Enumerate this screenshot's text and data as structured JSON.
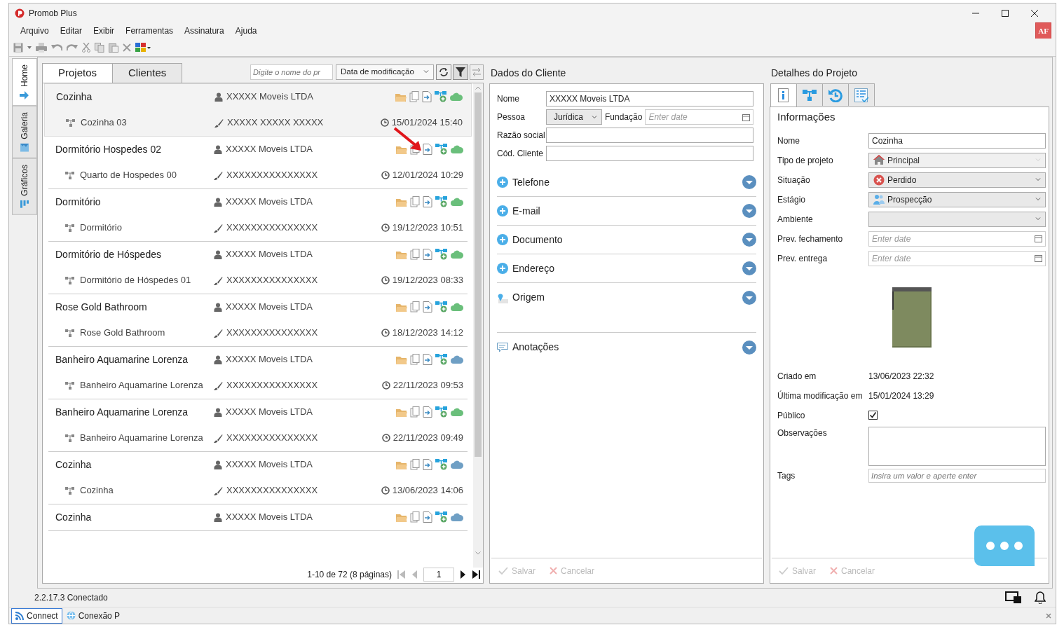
{
  "window": {
    "title": "Promob Plus"
  },
  "menu": [
    "Arquivo",
    "Editar",
    "Exibir",
    "Ferramentas",
    "Assinatura",
    "Ajuda"
  ],
  "user_badge": "AF",
  "side_tabs": [
    {
      "label": "Home",
      "selected": true
    },
    {
      "label": "Galeria",
      "selected": false
    },
    {
      "label": "Gráficos",
      "selected": false
    }
  ],
  "projects_panel": {
    "tabs": [
      {
        "label": "Projetos",
        "selected": true
      },
      {
        "label": "Clientes",
        "selected": false
      }
    ],
    "search": {
      "placeholder": "Digite o nome do pr"
    },
    "sort": "Data de modificação",
    "items": [
      {
        "title": "Cozinha",
        "client": "XXXXX Moveis LTDA",
        "subtitle": "Cozinha 03",
        "designer": "XXXXX XXXXX XXXXX",
        "date": "15/01/2024 15:40",
        "color": "#6abf7b",
        "selected": true
      },
      {
        "title": "Dormitório Hospedes 02",
        "client": "XXXXX Moveis LTDA",
        "subtitle": "Quarto de Hospedes 00",
        "designer": "XXXXXXXXXXXXXXX",
        "date": "12/01/2024 10:29",
        "color": "#6abf7b",
        "selected": false
      },
      {
        "title": "Dormitório",
        "client": "XXXXX Moveis LTDA",
        "subtitle": "Dormitório",
        "designer": "XXXXXXXXXXXXXXX",
        "date": "19/12/2023 10:51",
        "color": "#6abf7b",
        "selected": false
      },
      {
        "title": "Dormitório de Hóspedes",
        "client": "XXXXX Moveis LTDA",
        "subtitle": "Dormitório de Hóspedes 01",
        "designer": "XXXXXXXXXXXXXXX",
        "date": "19/12/2023 08:33",
        "color": "#6abf7b",
        "selected": false
      },
      {
        "title": "Rose Gold Bathroom",
        "client": "XXXXX Moveis LTDA",
        "subtitle": "Rose Gold Bathroom",
        "designer": "XXXXXXXXXXXXXXX",
        "date": "18/12/2023 14:12",
        "color": "#6abf7b",
        "selected": false
      },
      {
        "title": "Banheiro Aquamarine Lorenza",
        "client": "XXXXX Moveis LTDA",
        "subtitle": "Banheiro Aquamarine Lorenza",
        "designer": "XXXXXXXXXXXXXXX",
        "date": "22/11/2023 09:53",
        "color": "#6f9fc4",
        "selected": false
      },
      {
        "title": "Banheiro Aquamarine Lorenza",
        "client": "XXXXX Moveis LTDA",
        "subtitle": "Banheiro Aquamarine Lorenza",
        "designer": "XXXXXXXXXXXXXXX",
        "date": "22/11/2023 09:49",
        "color": "#6abf7b",
        "selected": false
      },
      {
        "title": "Cozinha",
        "client": "XXXXX Moveis LTDA",
        "subtitle": "Cozinha",
        "designer": "XXXXXXXXXXXXXXX",
        "date": "13/06/2023 14:06",
        "color": "#6f9fc4",
        "selected": false
      },
      {
        "title": "Cozinha",
        "client": "XXXXX Moveis LTDA",
        "color": "#6f9fc4",
        "selected": false
      }
    ],
    "pagination": {
      "summary": "1-10 de 72 (8 páginas)",
      "page": "1"
    }
  },
  "client_panel": {
    "title": "Dados do Cliente",
    "fields": [
      {
        "kind": "text",
        "label": "Nome",
        "value": "XXXXX Moveis LTDA"
      },
      {
        "kind": "select_date",
        "label": "Pessoa",
        "value": "Jurídica",
        "date_label": "Fundação",
        "date_placeholder": "Enter date"
      },
      {
        "kind": "text",
        "label": "Razão social"
      },
      {
        "kind": "text",
        "label": "Cód. Cliente"
      }
    ],
    "sections": [
      {
        "label": "Telefone",
        "kind": "plus"
      },
      {
        "label": "E-mail",
        "kind": "plus"
      },
      {
        "label": "Documento",
        "kind": "plus"
      },
      {
        "label": "Endereço",
        "kind": "plus"
      },
      {
        "label": "Origem",
        "kind": "pin"
      },
      {
        "label": "Anotações",
        "kind": "note"
      }
    ],
    "buttons": [
      {
        "label": "Salvar",
        "kind": "save",
        "disabled": true
      },
      {
        "label": "Cancelar",
        "kind": "cancel",
        "disabled": true
      }
    ]
  },
  "project_panel": {
    "title": "Detalhes do Projeto",
    "tabs": [
      {
        "kind": "info",
        "selected": true
      },
      {
        "kind": "hierarchy",
        "selected": false
      },
      {
        "kind": "history",
        "selected": false
      },
      {
        "kind": "checklist",
        "selected": false
      }
    ],
    "heading": "Informações",
    "fields": [
      {
        "kind": "text",
        "label": "Nome",
        "value": "Cozinha"
      },
      {
        "kind": "select",
        "label": "Tipo de projeto",
        "value": "Principal",
        "disabled": true
      },
      {
        "kind": "select",
        "label": "Situação",
        "value": "Perdido",
        "disabled": false
      },
      {
        "kind": "select",
        "label": "Estágio",
        "value": "Prospecção",
        "disabled": false
      },
      {
        "kind": "select",
        "label": "Ambiente",
        "disabled": false
      },
      {
        "kind": "date",
        "label": "Prev. fechamento",
        "placeholder": "Enter date"
      },
      {
        "kind": "date",
        "label": "Prev. entrega",
        "placeholder": "Enter date"
      }
    ],
    "info": [
      {
        "label": "Criado em",
        "value": "13/06/2023 22:32"
      },
      {
        "label": "Última modificação em",
        "value": "15/01/2024 13:29"
      }
    ],
    "public": {
      "label": "Público",
      "checked": true
    },
    "notes": {
      "label": "Observações"
    },
    "tags": {
      "label": "Tags",
      "placeholder": "Insira um valor e aperte enter"
    },
    "buttons": [
      {
        "label": "Salvar",
        "kind": "save",
        "disabled": true
      },
      {
        "label": "Cancelar",
        "kind": "cancel",
        "disabled": true
      }
    ]
  },
  "status_bar": {
    "text": "2.2.17.3 Conectado"
  },
  "bottom_tabs": [
    {
      "label": "Connect",
      "kind": "feed",
      "selected": true
    },
    {
      "label": "Conexão P",
      "kind": "globe",
      "selected": false
    }
  ]
}
